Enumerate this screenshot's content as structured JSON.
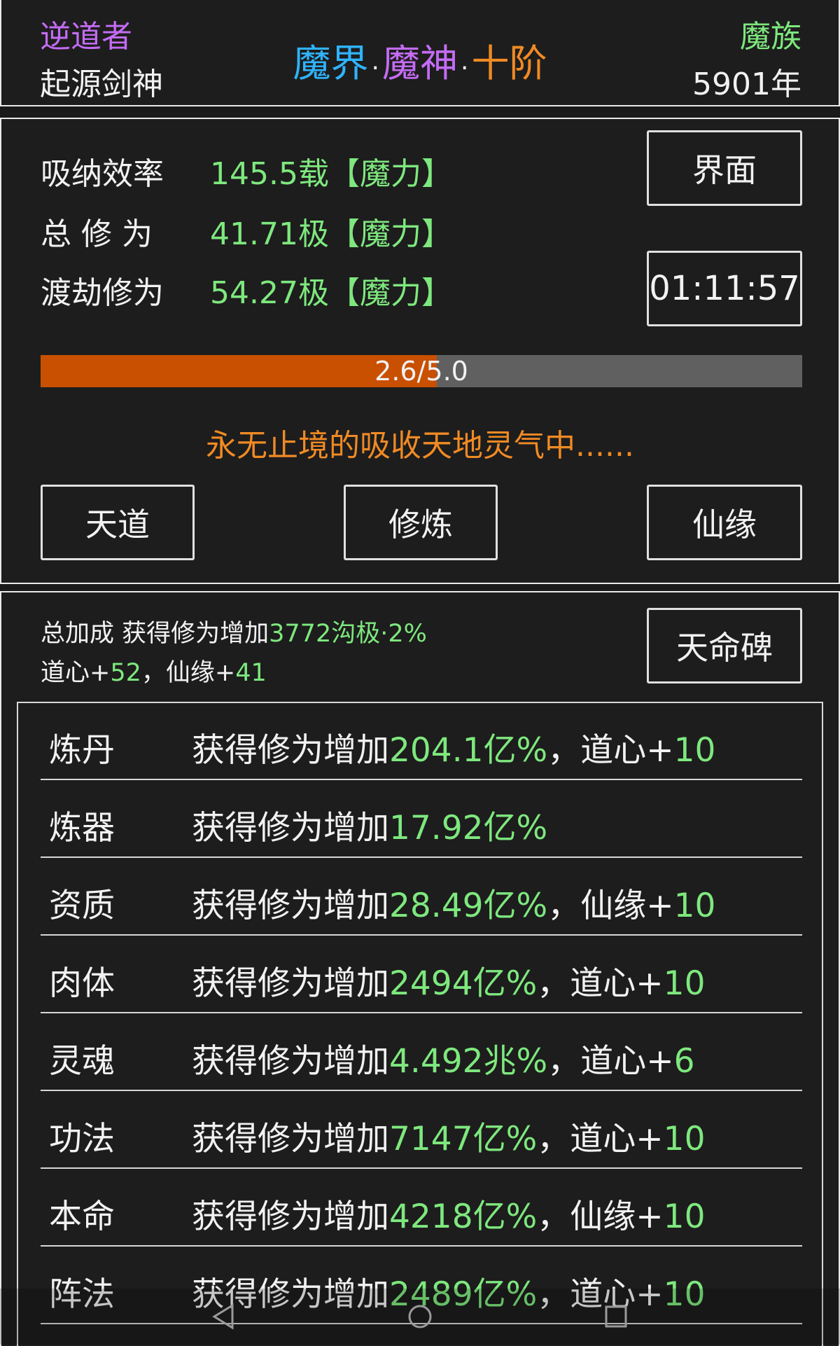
{
  "header": {
    "path_name": "逆道者",
    "title_name": "起源剑神",
    "realm": {
      "world": "魔界",
      "rank": "魔神",
      "stage": "十阶",
      "dot": "·"
    },
    "race": "魔族",
    "age": "5901年"
  },
  "stats": {
    "rows": [
      {
        "label": "吸纳效率",
        "value": "145.5载【魔力】"
      },
      {
        "label": "总 修 为",
        "value": "41.71极【魔力】"
      },
      {
        "label": "渡劫修为",
        "value": "54.27极【魔力】"
      }
    ],
    "interface_button": "界面",
    "timer": "01:11:57",
    "progress": {
      "current": 2.6,
      "max": 5.0,
      "text": "2.6/5.0"
    },
    "status_message": "永无止境的吸收天地灵气中......",
    "buttons": [
      "天道",
      "修炼",
      "仙缘"
    ]
  },
  "bonus": {
    "summary_prefix": "总加成 获得修为增加",
    "summary_value": "3772沟极·2%",
    "daoxin_label": "道心+",
    "daoxin_value": "52",
    "comma": "，",
    "xianyuan_label": "仙缘+",
    "xianyuan_value": "41",
    "stele_button": "天命碑",
    "desc_prefix": "获得修为增加",
    "rows": [
      {
        "name": "炼丹",
        "value": "204.1亿%",
        "extra_label": "道心+",
        "extra_value": "10"
      },
      {
        "name": "炼器",
        "value": "17.92亿%",
        "extra_label": "",
        "extra_value": ""
      },
      {
        "name": "资质",
        "value": "28.49亿%",
        "extra_label": "仙缘+",
        "extra_value": "10"
      },
      {
        "name": "肉体",
        "value": "2494亿%",
        "extra_label": "道心+",
        "extra_value": "10"
      },
      {
        "name": "灵魂",
        "value": "4.492兆%",
        "extra_label": "道心+",
        "extra_value": "6"
      },
      {
        "name": "功法",
        "value": "7147亿%",
        "extra_label": "道心+",
        "extra_value": "10"
      },
      {
        "name": "本命",
        "value": "4218亿%",
        "extra_label": "仙缘+",
        "extra_value": "10"
      },
      {
        "name": "阵法",
        "value": "2489亿%",
        "extra_label": "道心+",
        "extra_value": "10"
      }
    ]
  },
  "colors": {
    "purple": "#c46cf5",
    "cyan": "#2fb4ff",
    "orange": "#f08a24",
    "green": "#7ee87e",
    "progress_fill": "#c85000"
  },
  "navbar": {
    "icons": [
      "back-icon",
      "home-icon",
      "recents-icon"
    ]
  }
}
